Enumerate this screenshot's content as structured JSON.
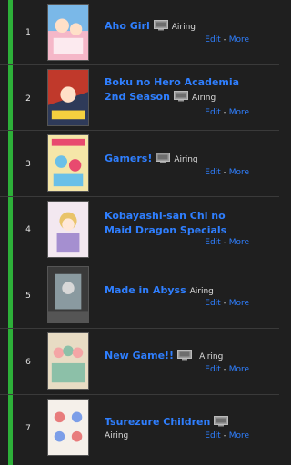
{
  "anime_list": [
    {
      "rank": "1",
      "title": "Aho Girl",
      "status": "Airing",
      "edit": "Edit",
      "sep": " - ",
      "more": "More",
      "palette": [
        "#f5b7c8",
        "#7ab8e8",
        "#ffffff"
      ]
    },
    {
      "rank": "2",
      "title_line1": "Boku no Hero Academia",
      "title_line2": "2nd Season",
      "status": "Airing",
      "edit": "Edit",
      "sep": " - ",
      "more": "More",
      "palette": [
        "#c0392b",
        "#2e3a59",
        "#f4d03f"
      ]
    },
    {
      "rank": "3",
      "title": "Gamers!",
      "status": "Airing",
      "edit": "Edit",
      "sep": " - ",
      "more": "More",
      "palette": [
        "#f5e6a8",
        "#e84a6f",
        "#6bc0e8"
      ]
    },
    {
      "rank": "4",
      "title_line1": "Kobayashi-san Chi no",
      "title_line2": "Maid Dragon Specials",
      "edit": "Edit",
      "sep": " - ",
      "more": "More",
      "palette": [
        "#f3e8f0",
        "#a58fd0",
        "#e9c46a"
      ]
    },
    {
      "rank": "5",
      "title": "Made in Abyss",
      "status": "Airing",
      "edit": "Edit",
      "sep": " - ",
      "more": "More",
      "palette": [
        "#3a3a3a",
        "#8a9aa0",
        "#d8d8d8"
      ]
    },
    {
      "rank": "6",
      "title": "New Game!!",
      "status": "Airing",
      "edit": "Edit",
      "sep": " - ",
      "more": "More",
      "palette": [
        "#e8dcc4",
        "#8cc0a8",
        "#f4a6a6"
      ]
    },
    {
      "rank": "7",
      "title": "Tsurezure Children",
      "status": "Airing",
      "edit": "Edit",
      "sep": " - ",
      "more": "More",
      "palette": [
        "#f5f0ea",
        "#e87c7c",
        "#7c9ee8"
      ]
    }
  ],
  "colors": {
    "status_bar": "#2db039",
    "link": "#2f7fff",
    "background": "#1f1f1f"
  }
}
